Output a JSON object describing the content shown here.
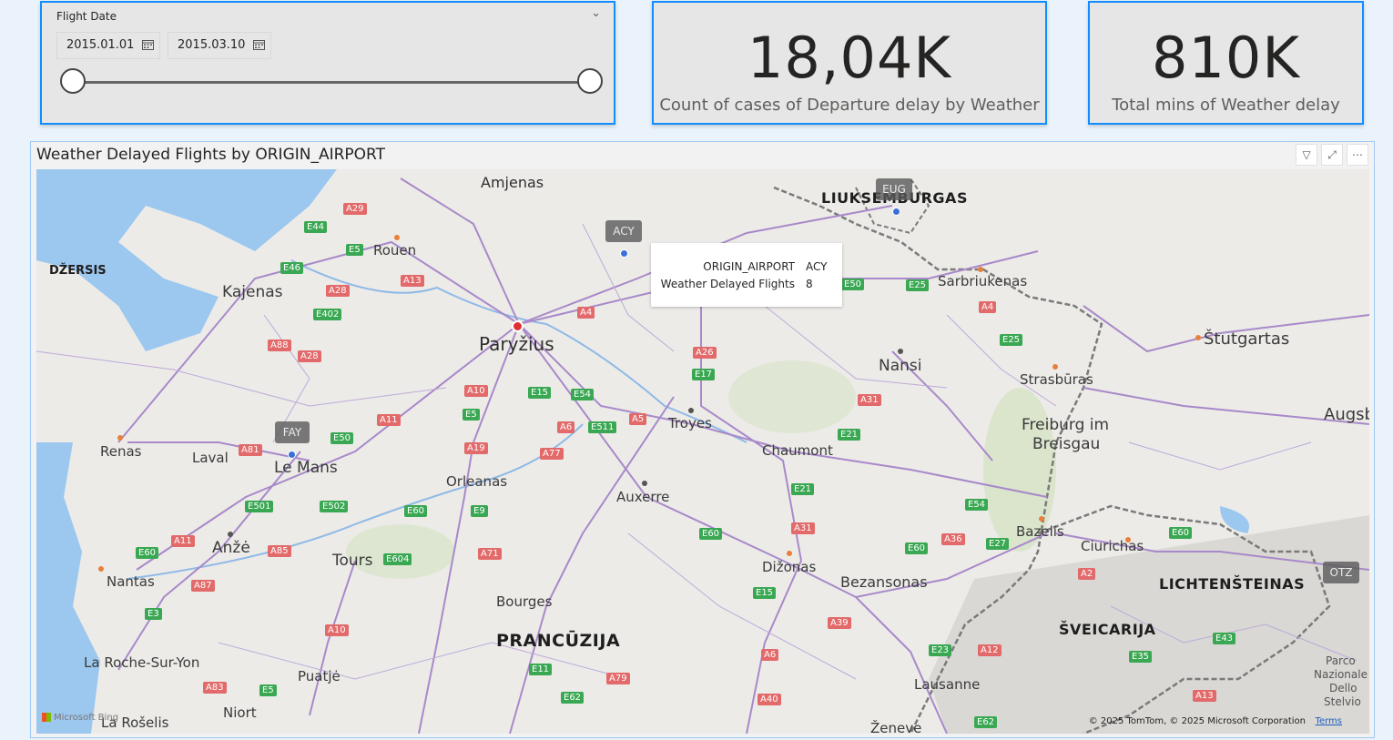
{
  "slicer": {
    "title": "Flight Date",
    "start_date": "2015.01.01",
    "end_date": "2015.03.10"
  },
  "kpis": [
    {
      "value": "18,04K",
      "label": "Count of cases of Departure delay by Weather"
    },
    {
      "value": "810K",
      "label": "Total mins of Weather delay"
    }
  ],
  "map": {
    "title": "Weather Delayed Flights by ORIGIN_AIRPORT",
    "tooltip": {
      "rows": [
        {
          "key": "ORIGIN_AIRPORT",
          "value": "ACY"
        },
        {
          "key": "Weather Delayed Flights",
          "value": "8"
        }
      ]
    },
    "markers": [
      "ACY",
      "EUG",
      "FAY",
      "OTZ"
    ],
    "places": {
      "amjenas": "Amjenas",
      "rouen": "Rouen",
      "kajenas": "Kajenas",
      "dzersis": "DŽERSIS",
      "paryzius": "Paryžius",
      "renas": "Renas",
      "laval": "Laval",
      "lemans": "Le Mans",
      "orleanas": "Orleanas",
      "troyes": "Troyes",
      "auxerre": "Auxerre",
      "chaumont": "Chaumont",
      "nansi": "Nansi",
      "strasburas": "Strasbūras",
      "freiburg": "Freiburg im",
      "breisgau": "Breisgau",
      "stutgartas": "Štutgartas",
      "augsb": "Augsb",
      "sarbriukenas": "Sarbriukenas",
      "liuksemburgas": "LIUKSEMBURGAS",
      "anze": "Anžė",
      "nantas": "Nantas",
      "tours": "Tours",
      "bourges": "Bourges",
      "dizonas": "Dižonas",
      "bezansonas": "Bezansonas",
      "bazelis": "Bazelis",
      "ciurichas": "Ciurichas",
      "lichtensteinas": "LICHTENŠTEINAS",
      "sveicarija": "ŠVEICARIJA",
      "prancuzija": "PRANCŪZIJA",
      "larochesuryon": "La Roche-Sur-Yon",
      "puatje": "Puatjė",
      "niort": "Niort",
      "larosele": "La Rošelis",
      "lausanne": "Lausanne",
      "zeneve": "Ženeve",
      "parco1": "Parco",
      "parco2": "Nazionale",
      "parco3": "Dello",
      "parco4": "Stelvio"
    },
    "roads": {
      "A29": "A29",
      "E44": "E44",
      "E5a": "E5",
      "E46": "E46",
      "A28a": "A28",
      "A13": "A13",
      "E402": "E402",
      "A88": "A88",
      "A28b": "A28",
      "A4": "A4",
      "A26": "A26",
      "E17": "E17",
      "A10": "A10",
      "E15": "E15",
      "E54": "E54",
      "E5b": "E5",
      "A11": "A11",
      "A6": "A6",
      "E511": "E511",
      "A5": "A5",
      "A19": "A19",
      "A77": "A77",
      "A81": "A81",
      "E50a": "E50",
      "E501": "E501",
      "E502": "E502",
      "E60a": "E60",
      "E9": "E9",
      "A11b": "A11",
      "A85": "A85",
      "E604": "E604",
      "A71": "A71",
      "E60b": "E60",
      "A87": "A87",
      "E3": "E3",
      "A10b": "A10",
      "E11": "E11",
      "A79": "A79",
      "A83": "A83",
      "E5c": "E5",
      "E62": "E62",
      "A6b": "A6",
      "A40": "A40",
      "A39": "A39",
      "E15b": "E15",
      "A31a": "A31",
      "E21a": "E21",
      "E21b": "E21",
      "A31b": "A31",
      "E54b": "E54",
      "E60c": "E60",
      "A36": "A36",
      "E27": "E27",
      "E60d": "E60",
      "A2": "A2",
      "E43": "E43",
      "E35": "E35",
      "A13b": "A13",
      "E23": "E23",
      "A12": "A12",
      "E62b": "E62",
      "E50b": "E50",
      "E25a": "E25",
      "A4b": "A4",
      "E25b": "E25"
    },
    "attribution": {
      "bing": "Microsoft Bing",
      "copyright": "© 2025 TomTom, © 2025 Microsoft Corporation",
      "terms": "Terms"
    }
  },
  "colors": {
    "accent_border": "#118dff",
    "card_bg": "#e6e6e6",
    "page_bg": "#eaf3fb",
    "marker_bg": "#5a5a5a",
    "pin": "#3b6fd8"
  }
}
